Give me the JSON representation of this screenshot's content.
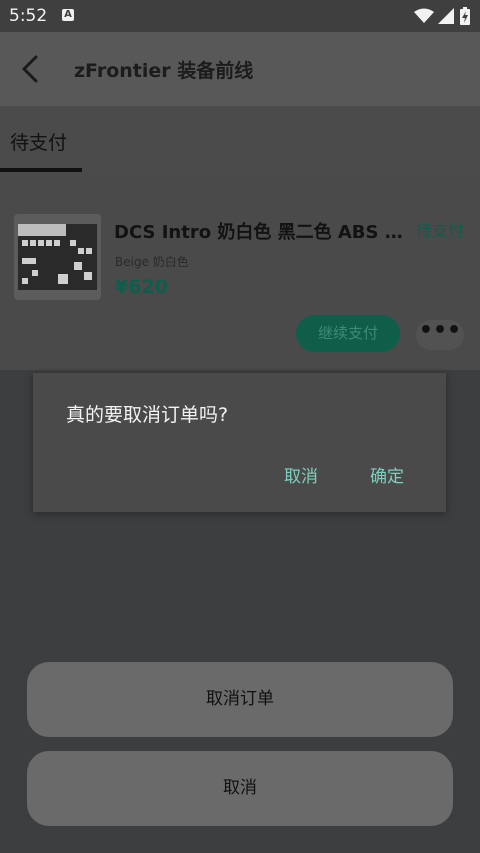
{
  "status_bar": {
    "time": "5:52",
    "notification_icon": "a-letter-icon",
    "icons": [
      "wifi-icon",
      "signal-icon",
      "battery-charging-icon"
    ]
  },
  "app_bar": {
    "back_icon": "back-arrow-icon",
    "title": "zFrontier 装备前线"
  },
  "tabs": [
    {
      "label": "待支付",
      "selected": true
    }
  ],
  "order": {
    "product_title": "DCS Intro 奶白色 黑二色 ABS 二…",
    "status": "待支付",
    "variant": "Beige 奶白色",
    "price": "¥620",
    "continue_pay_label": "继续支付",
    "more_label": "•••"
  },
  "dialog": {
    "message": "真的要取消订单吗?",
    "cancel_label": "取消",
    "confirm_label": "确定"
  },
  "bottom_sheet": {
    "cancel_order_label": "取消订单",
    "cancel_label": "取消"
  },
  "colors": {
    "accent": "#0d5e4c",
    "dialog_action": "#7fcfbe",
    "scrim": "#3d3e40"
  }
}
